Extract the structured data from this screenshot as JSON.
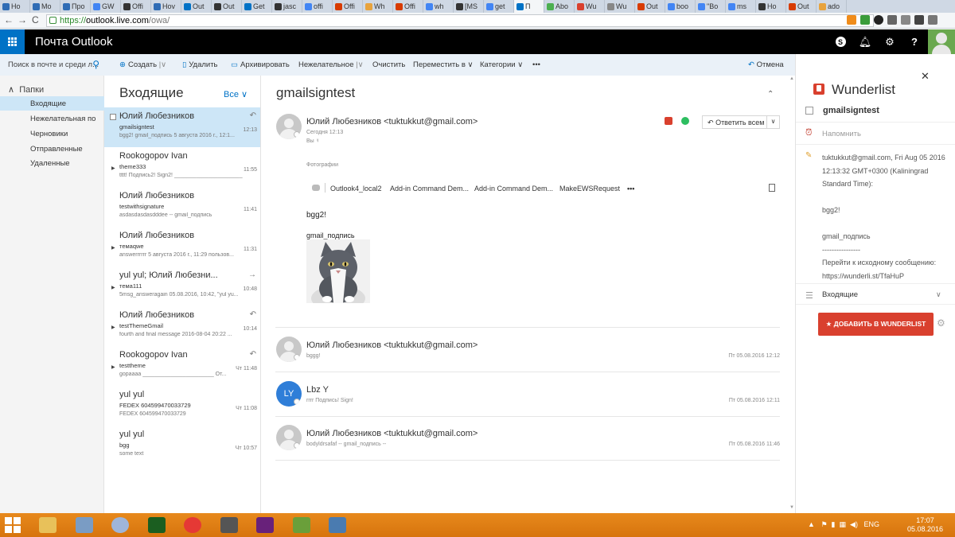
{
  "browser": {
    "tabs": [
      {
        "label": "Ho",
        "color": "#2f6cb5"
      },
      {
        "label": "Mo",
        "color": "#2f6cb5"
      },
      {
        "label": "Про",
        "color": "#2f6cb5"
      },
      {
        "label": "GW",
        "color": "#4285f4"
      },
      {
        "label": "Offi",
        "color": "#333333"
      },
      {
        "label": "Hov",
        "color": "#2f6cb5"
      },
      {
        "label": "Out",
        "color": "#0072c6"
      },
      {
        "label": "Out",
        "color": "#333333"
      },
      {
        "label": "Get",
        "color": "#0072c6"
      },
      {
        "label": "jasc",
        "color": "#333333"
      },
      {
        "label": "offi",
        "color": "#4285f4"
      },
      {
        "label": "Offi",
        "color": "#d83b01"
      },
      {
        "label": "Wh",
        "color": "#e8a33d"
      },
      {
        "label": "Offi",
        "color": "#d83b01"
      },
      {
        "label": "wh",
        "color": "#4285f4"
      },
      {
        "label": "[MS",
        "color": "#333333"
      },
      {
        "label": "get",
        "color": "#4285f4"
      },
      {
        "label": "П",
        "color": "#0072c6"
      },
      {
        "label": "Abo",
        "color": "#4caf50"
      },
      {
        "label": "Wu",
        "color": "#d9402e"
      },
      {
        "label": "Wu",
        "color": "#888888"
      },
      {
        "label": "Out",
        "color": "#d83b01"
      },
      {
        "label": "boo",
        "color": "#4285f4"
      },
      {
        "label": "\"Bo",
        "color": "#4285f4"
      },
      {
        "label": "ms",
        "color": "#4285f4"
      },
      {
        "label": "Ho",
        "color": "#333333"
      },
      {
        "label": "Out",
        "color": "#d83b01"
      },
      {
        "label": "ado",
        "color": "#e8a33d"
      }
    ],
    "url_prefix": "https://",
    "url_host": "outlook.live.com",
    "url_path": "/owa/"
  },
  "app": {
    "title": "Почта Outlook"
  },
  "commands": {
    "search_placeholder": "Поиск в почте и среди л...",
    "new": "Создать",
    "delete": "Удалить",
    "archive": "Архивировать",
    "junk": "Нежелательное",
    "sweep": "Очистить",
    "move": "Переместить в",
    "categories": "Категории",
    "more": "•••",
    "undo": "Отмена"
  },
  "folders": {
    "header": "Папки",
    "items": [
      {
        "label": "Входящие"
      },
      {
        "label": "Нежелательная по"
      },
      {
        "label": "Черновики"
      },
      {
        "label": "Отправленные"
      },
      {
        "label": "Удаленные"
      }
    ]
  },
  "list": {
    "title": "Входящие",
    "filter": "Все",
    "messages": [
      {
        "from": "Юлий Любезников",
        "subject": "gmailsigntest",
        "preview": "bgg2! gmail_подпись 5 августа 2016 г., 12:1...",
        "time": "12:13",
        "icon": "↶"
      },
      {
        "from": "Rookogopov Ivan",
        "subject": "theme333",
        "preview": "tttt! Подпись2! Sign2! ______________________",
        "time": "11:55",
        "icon": ""
      },
      {
        "from": "Юлий Любезников",
        "subject": "testwithsignature",
        "preview": "asdasdasdasdddee -- gmail_подпись",
        "time": "11:41",
        "icon": ""
      },
      {
        "from": "Юлий Любезников",
        "subject": "темаqwe",
        "preview": "answerrrrrr 5 августа 2016 г., 11:29 пользов...",
        "time": "11:31",
        "icon": ""
      },
      {
        "from": "yul yul; Юлий Любезни...",
        "subject": "тема111",
        "preview": "5msg_answeragain 05.08.2016, 10:42, \"yul yu...",
        "time": "10:48",
        "icon": "→"
      },
      {
        "from": "Юлий Любезников",
        "subject": "testThemeGmail",
        "preview": "fourth and final message 2016-08-04 20:22 ...",
        "time": "10:14",
        "icon": "↶"
      },
      {
        "from": "Rookogopov Ivan",
        "subject": "testtheme",
        "preview": "gopaaaa _______________________ От...",
        "time": "Чт 11:48",
        "icon": "↶"
      },
      {
        "from": "yul yul",
        "subject": "FEDEX 604599470033729",
        "preview": "FEDEX 604599470033729",
        "time": "Чт 11:08",
        "icon": ""
      },
      {
        "from": "yul yul",
        "subject": "bgg",
        "preview": "some text",
        "time": "Чт 10:57",
        "icon": ""
      }
    ]
  },
  "reading": {
    "subject": "gmailsigntest",
    "main": {
      "sender": "Юлий Любезников <tuktukkut@gmail.com>",
      "time": "Сегодня 12:13",
      "to": "Вы ☿",
      "reply_all": "Ответить всем",
      "photos_label": "Фотографии",
      "addins": [
        "Outlook4_local2",
        "Add-in Command Dem...",
        "Add-in Command Dem...",
        "MakeEWSRequest",
        "•••"
      ],
      "body_line1": "bgg2!",
      "body_line2": "gmail_подпись"
    },
    "thread": [
      {
        "sender": "Юлий Любезников <tuktukkut@gmail.com>",
        "preview": "bggg!",
        "date": "Пт 05.08.2016 12:12",
        "initials": ""
      },
      {
        "sender": "Lbz Y",
        "preview": "rrrr Подпись! Sign!",
        "date": "Пт 05.08.2016 12:11",
        "initials": "LY"
      },
      {
        "sender": "Юлий Любезников <tuktukkut@gmail.com>",
        "preview": "bodyldrsafaf -- gmail_подпись --",
        "date": "Пт 05.08.2016 11:46",
        "initials": ""
      }
    ]
  },
  "wunderlist": {
    "title": "Wunderlist",
    "task": "gmailsigntest",
    "remind": "Напомнить",
    "note_lines": [
      "tuktukkut@gmail.com, Fri Aug 05 2016",
      "12:13:32 GMT+0300 (Kaliningrad",
      "Standard Time):",
      "",
      "bgg2!",
      "",
      "gmail_подпись",
      "----------------",
      "Перейти к исходному сообщению:",
      "https://wunderli.st/TfaHuP"
    ],
    "list": "Входящие",
    "button": "★ ДОБАВИТЬ В WUNDERLIST",
    "brand_color": "#d9402e"
  },
  "taskbar": {
    "apps": [
      {
        "name": "file-explorer",
        "color": "#e8c15a"
      },
      {
        "name": "network-app",
        "color": "#7a9cc4"
      },
      {
        "name": "chrome-canary",
        "color": "#9fb5d8"
      },
      {
        "name": "webstorm",
        "color": "#1b5e20"
      },
      {
        "name": "chrome",
        "color": "#e53935"
      },
      {
        "name": "sublime",
        "color": "#555555"
      },
      {
        "name": "visual-studio",
        "color": "#68217a"
      },
      {
        "name": "image-app",
        "color": "#6a9f3a"
      },
      {
        "name": "photos-app",
        "color": "#4a7bb0"
      }
    ],
    "lang": "ENG",
    "time": "17:07",
    "date": "05.08.2016"
  }
}
